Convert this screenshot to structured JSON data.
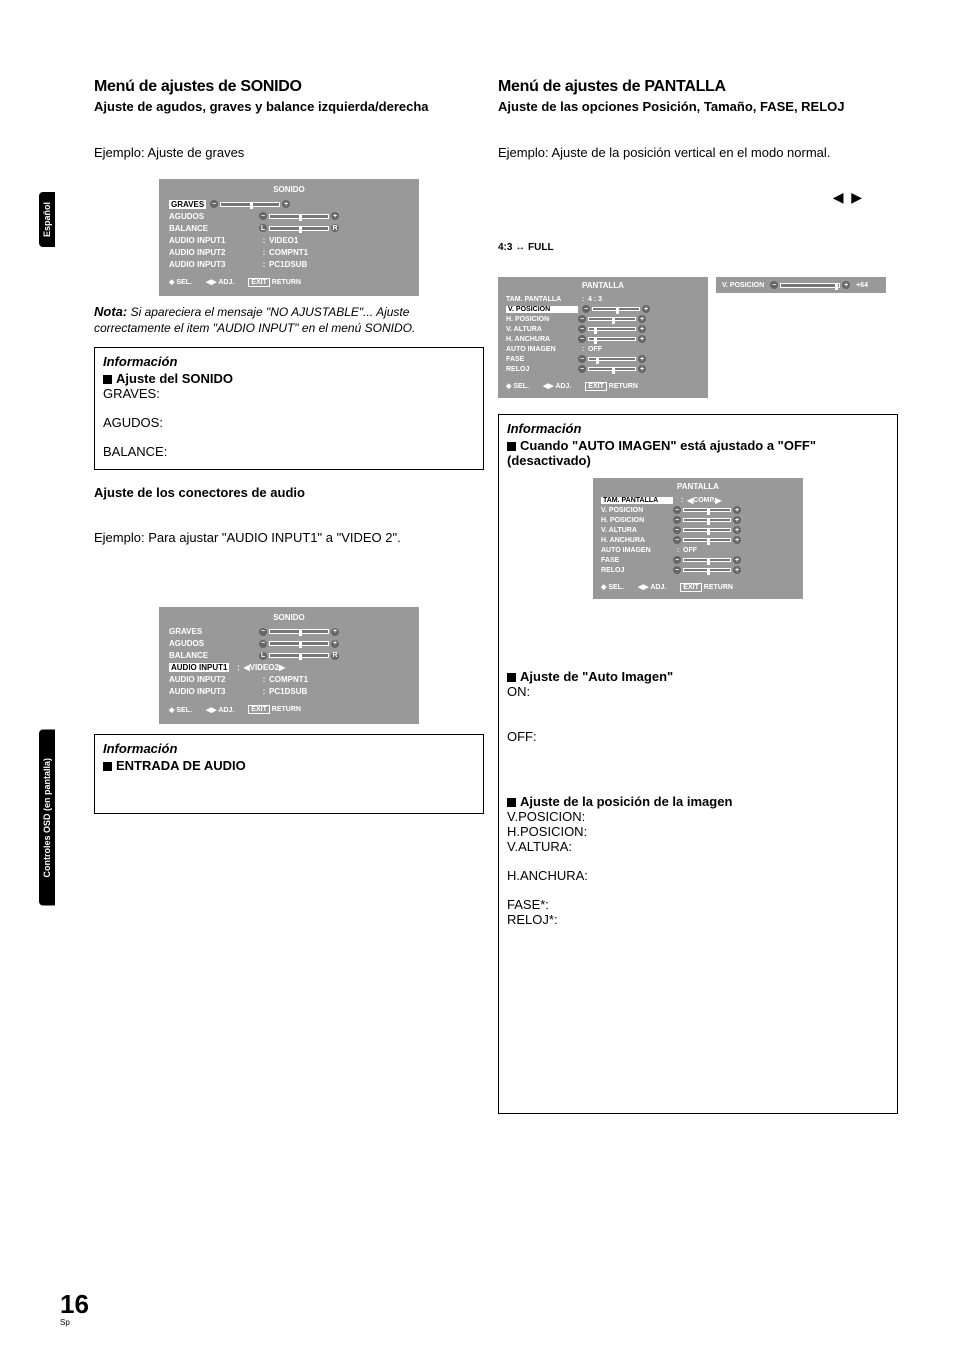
{
  "sidebar": {
    "tab1": "Español",
    "tab2": "Controles OSD (en pantalla)"
  },
  "page": {
    "num": "16",
    "suffix": "Sp"
  },
  "left": {
    "title": "Menú de ajustes de SONIDO",
    "subtitle": "Ajuste de agudos, graves y balance izquierda/derecha",
    "example1": "Ejemplo: Ajuste de graves",
    "note_label": "Nota:",
    "note_text": "Si apareciera el mensaje \"NO AJUSTABLE\"... Ajuste correctamente el item \"AUDIO INPUT\" en el menú SONIDO.",
    "info1_title": "Información",
    "info1_sub": "Ajuste del SONIDO",
    "info1_rows": [
      "GRAVES:",
      "AGUDOS:",
      "BALANCE:"
    ],
    "connectors_title": "Ajuste de los conectores de audio",
    "example2": "Ejemplo: Para ajustar \"AUDIO INPUT1\" a \"VIDEO 2\".",
    "info2_title": "Información",
    "info2_sub": "ENTRADA DE AUDIO"
  },
  "right": {
    "title": "Menú de ajustes de PANTALLA",
    "subtitle": "Ajuste de las opciones Posición, Tamaño, FASE, RELOJ",
    "example": "Ejemplo: Ajuste de la posición vertical en el modo normal.",
    "modeline": "4:3 ↔ FULL",
    "info_title": "Información",
    "info_sub": "Cuando \"AUTO IMAGEN\" está ajustado a \"OFF\" (desactivado)",
    "auto_title": "Ajuste de \"Auto Imagen\"",
    "auto_on": "ON:",
    "auto_off": "OFF:",
    "pos_title": "Ajuste de la posición de la imagen",
    "pos_rows": [
      "V.POSICION:",
      "H.POSICION:",
      "V.ALTURA:",
      "H.ANCHURA:",
      "FASE*:",
      "RELOJ*:"
    ]
  },
  "osd1": {
    "title": "SONIDO",
    "rows": [
      {
        "label": "GRAVES",
        "sel": true,
        "type": "bar",
        "handle": 50
      },
      {
        "label": "AGUDOS",
        "type": "bar",
        "handle": 50
      },
      {
        "label": "BALANCE",
        "type": "bar",
        "handle": 50,
        "lr": true
      },
      {
        "label": "AUDIO INPUT1",
        "type": "val",
        "val": "VIDEO1"
      },
      {
        "label": "AUDIO INPUT2",
        "type": "val",
        "val": "COMPNT1"
      },
      {
        "label": "AUDIO INPUT3",
        "type": "val",
        "val": "PC1DSUB"
      }
    ],
    "footer": {
      "sel": "SEL.",
      "adj": "ADJ.",
      "exit": "EXIT",
      "ret": "RETURN"
    }
  },
  "osd2": {
    "title": "SONIDO",
    "rows": [
      {
        "label": "GRAVES",
        "type": "bar",
        "handle": 50
      },
      {
        "label": "AGUDOS",
        "type": "bar",
        "handle": 50
      },
      {
        "label": "BALANCE",
        "type": "bar",
        "handle": 50,
        "lr": true
      },
      {
        "label": "AUDIO INPUT1",
        "sel": true,
        "type": "valchev",
        "val": "VIDEO2"
      },
      {
        "label": "AUDIO INPUT2",
        "type": "val",
        "val": "COMPNT1"
      },
      {
        "label": "AUDIO INPUT3",
        "type": "val",
        "val": "PC1DSUB"
      }
    ],
    "footer": {
      "sel": "SEL.",
      "adj": "ADJ.",
      "exit": "EXIT",
      "ret": "RETURN"
    }
  },
  "osd_pantalla": {
    "title": "PANTALLA",
    "rows": [
      {
        "label": "TAM. PANTALLA",
        "type": "val",
        "val": "4 : 3"
      },
      {
        "label": "V. POSICION",
        "sel": true,
        "type": "bar",
        "handle": 50
      },
      {
        "label": "H. POSICION",
        "type": "bar",
        "handle": 50
      },
      {
        "label": "V. ALTURA",
        "type": "bar",
        "handle": 10
      },
      {
        "label": "H. ANCHURA",
        "type": "bar",
        "handle": 10
      },
      {
        "label": "AUTO IMAGEN",
        "type": "val",
        "val": "OFF"
      },
      {
        "label": "FASE",
        "type": "bar",
        "handle": 15
      },
      {
        "label": "RELOJ",
        "type": "bar",
        "handle": 50
      }
    ],
    "footer": {
      "sel": "SEL.",
      "adj": "ADJ.",
      "exit": "EXIT",
      "ret": "RETURN"
    }
  },
  "osd_vpos": {
    "label": "V. POSICION",
    "val": "+64"
  },
  "osd_pantalla2": {
    "title": "PANTALLA",
    "rows": [
      {
        "label": "TAM. PANTALLA",
        "sel": true,
        "type": "valchev",
        "val": "COMP."
      },
      {
        "label": "V. POSICION",
        "type": "bar",
        "handle": 50
      },
      {
        "label": "H. POSICION",
        "type": "bar",
        "handle": 50
      },
      {
        "label": "V. ALTURA",
        "type": "bar",
        "handle": 50
      },
      {
        "label": "H. ANCHURA",
        "type": "bar",
        "handle": 50
      },
      {
        "label": "AUTO IMAGEN",
        "type": "val",
        "val": "OFF"
      },
      {
        "label": "FASE",
        "type": "bar",
        "handle": 50
      },
      {
        "label": "RELOJ",
        "type": "bar",
        "handle": 50
      }
    ],
    "footer": {
      "sel": "SEL.",
      "adj": "ADJ.",
      "exit": "EXIT",
      "ret": "RETURN"
    }
  }
}
